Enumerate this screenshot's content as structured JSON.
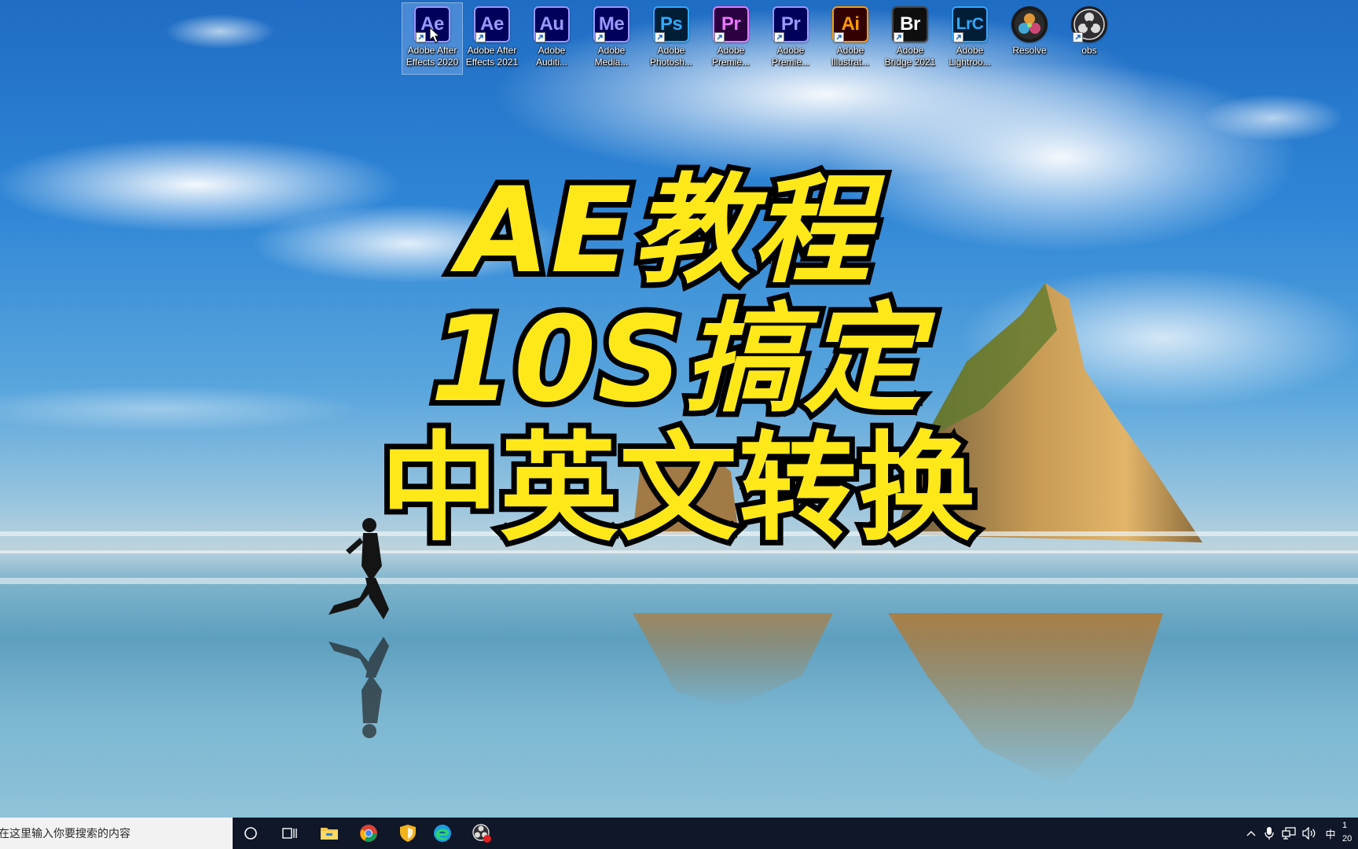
{
  "desktop": {
    "icons": [
      {
        "abbr": "Ae",
        "label": "Adobe After\nEffects 2020",
        "bg": "#00005b",
        "fg": "#9999ff",
        "border": "#9999ff"
      },
      {
        "abbr": "Ae",
        "label": "Adobe After\nEffects 2021",
        "bg": "#00005b",
        "fg": "#9999ff",
        "border": "#9999ff"
      },
      {
        "abbr": "Au",
        "label": "Adobe\nAuditi...",
        "bg": "#00005b",
        "fg": "#9999ff",
        "border": "#9999ff"
      },
      {
        "abbr": "Me",
        "label": "Adobe\nMedia...",
        "bg": "#00005b",
        "fg": "#9999ff",
        "border": "#9999ff"
      },
      {
        "abbr": "Ps",
        "label": "Adobe\nPhotosh...",
        "bg": "#001e36",
        "fg": "#31a8ff",
        "border": "#31a8ff"
      },
      {
        "abbr": "Pr",
        "label": "Adobe\nPremie...",
        "bg": "#2a0040",
        "fg": "#ea77ff",
        "border": "#ea77ff"
      },
      {
        "abbr": "Pr",
        "label": "Adobe\nPremie...",
        "bg": "#00005b",
        "fg": "#9999ff",
        "border": "#9999ff"
      },
      {
        "abbr": "Ai",
        "label": "Adobe\nIllustrat...",
        "bg": "#330000",
        "fg": "#ff9a00",
        "border": "#ff9a00"
      },
      {
        "abbr": "Br",
        "label": "Adobe\nBridge 2021",
        "bg": "#0f0f0f",
        "fg": "#ffffff",
        "border": "#444444"
      },
      {
        "abbr": "LrC",
        "label": "Adobe\nLightroo...",
        "bg": "#001e36",
        "fg": "#31a8ff",
        "border": "#31a8ff"
      },
      {
        "abbr": "",
        "label": "Resolve",
        "bg": "#1a1a1a",
        "fg": "#ffffff",
        "border": "#1a1a1a",
        "icon": "davinci-resolve-icon"
      },
      {
        "abbr": "",
        "label": "obs",
        "bg": "#1e1e1e",
        "fg": "#ffffff",
        "border": "#1e1e1e",
        "icon": "obs-icon"
      }
    ]
  },
  "overlay": {
    "line1": "AE教程",
    "line2": "10S搞定",
    "line3": "中英文转换",
    "color": "#ffe81a",
    "stroke": "#000000"
  },
  "taskbar": {
    "search_placeholder": "在这里输入你要搜索的内容",
    "ime_label": "中",
    "clock_time": "1",
    "clock_date": "20"
  }
}
